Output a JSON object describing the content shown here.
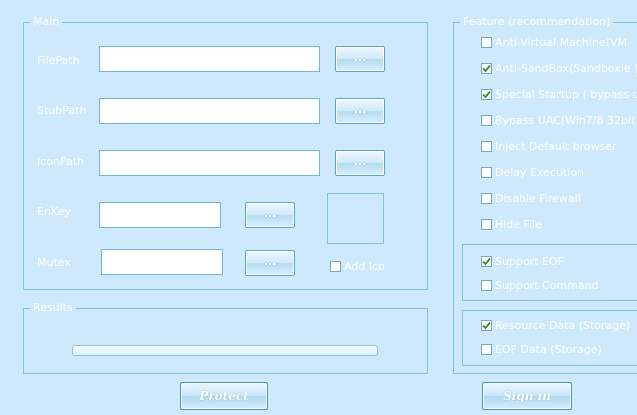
{
  "main": {
    "legend": "Main",
    "filepath_label": "FilePath",
    "stubpath_label": "StubPath",
    "iconpath_label": "IconPath",
    "enkey_label": "EnKey",
    "mutex_label": "Mutex",
    "filepath_value": "",
    "stubpath_value": "",
    "iconpath_value": "",
    "enkey_value": "",
    "mutex_value": "",
    "browse_label": "...",
    "add_ico_label": "Add Ico",
    "add_ico_checked": false
  },
  "results": {
    "legend": "Results",
    "progress": 0
  },
  "feature": {
    "legend": "Feature (recommendation)",
    "options": [
      {
        "label": "Anti-Virtual Machine(VM",
        "checked": false
      },
      {
        "label": "Anti-SandBox(Sandboxie )",
        "checked": true
      },
      {
        "label": "Special Startup ( bypass d",
        "checked": true
      },
      {
        "label": "Bypass UAC(Win7/8 32bit)",
        "checked": false
      },
      {
        "label": "Inject Default browser",
        "checked": false
      },
      {
        "label": "Delay Execution",
        "checked": false
      },
      {
        "label": "Disable Firewall",
        "checked": false
      },
      {
        "label": "Hide File",
        "checked": false
      }
    ],
    "eof_options": [
      {
        "label": "Support EOF",
        "checked": true
      },
      {
        "label": "Support Command",
        "checked": false
      }
    ],
    "storage_options": [
      {
        "label": "Resource Data (Storage)",
        "checked": true
      },
      {
        "label": "EOF Data (Storage)",
        "checked": false
      }
    ]
  },
  "actions": {
    "protect_label": "Protect",
    "sign_in_label": "Sign in"
  },
  "colors": {
    "background": "#cde9fb",
    "border": "#7fc4dc",
    "check": "#3a8a2a"
  }
}
